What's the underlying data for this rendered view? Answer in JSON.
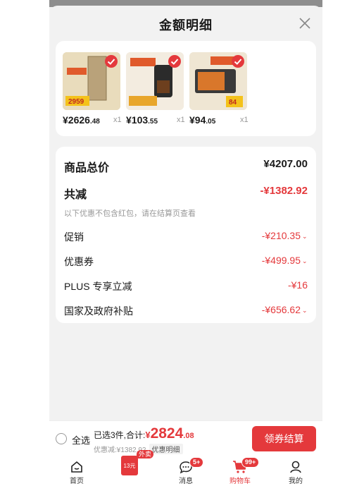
{
  "sheet": {
    "title": "金额明细"
  },
  "products": [
    {
      "image_text": "2959",
      "image_color": "#c9b27f",
      "price_int": "¥2626",
      "price_dec": ".48",
      "qty": "x1"
    },
    {
      "image_text": "",
      "image_color": "#b0622e",
      "price_int": "¥103",
      "price_dec": ".55",
      "qty": "x1"
    },
    {
      "image_text": "84",
      "image_color": "#7a6a52",
      "price_int": "¥94",
      "price_dec": ".05",
      "qty": "x1"
    }
  ],
  "summary": {
    "total_label": "商品总价",
    "total_value": "¥4207.00",
    "reduce_label": "共减",
    "reduce_value": "-¥1382.92",
    "note": "以下优惠不包含红包，请在结算页查看",
    "items": [
      {
        "label": "促销",
        "value": "-¥210.35",
        "chevron": true
      },
      {
        "label": "优惠券",
        "value": "-¥499.95",
        "chevron": true
      },
      {
        "label": "PLUS 专享立减",
        "value": "-¥16",
        "chevron": false
      },
      {
        "label": "国家及政府补贴",
        "value": "-¥656.62",
        "chevron": true
      }
    ]
  },
  "bottom": {
    "select_all": "全选",
    "selected_text": "已选3件,合计:",
    "currency": "¥",
    "amount_int": "2824",
    "amount_dec": ".08",
    "discount_text": "优惠减:¥1382.92",
    "detail_chip": "优惠明细",
    "checkout": "领券结算"
  },
  "tabs": [
    {
      "label": "首页",
      "icon": "home-icon"
    },
    {
      "label": "",
      "icon": "takeout-icon",
      "badge": "外卖",
      "box_text": "13元"
    },
    {
      "label": "消息",
      "icon": "message-icon",
      "badge": "5+"
    },
    {
      "label": "购物车",
      "icon": "cart-icon",
      "badge": "99+",
      "active": true
    },
    {
      "label": "我的",
      "icon": "profile-icon"
    }
  ],
  "colors": {
    "accent": "#e4393c",
    "text": "#1a1a1a",
    "muted": "#999999",
    "bg": "#f2f2f2"
  }
}
